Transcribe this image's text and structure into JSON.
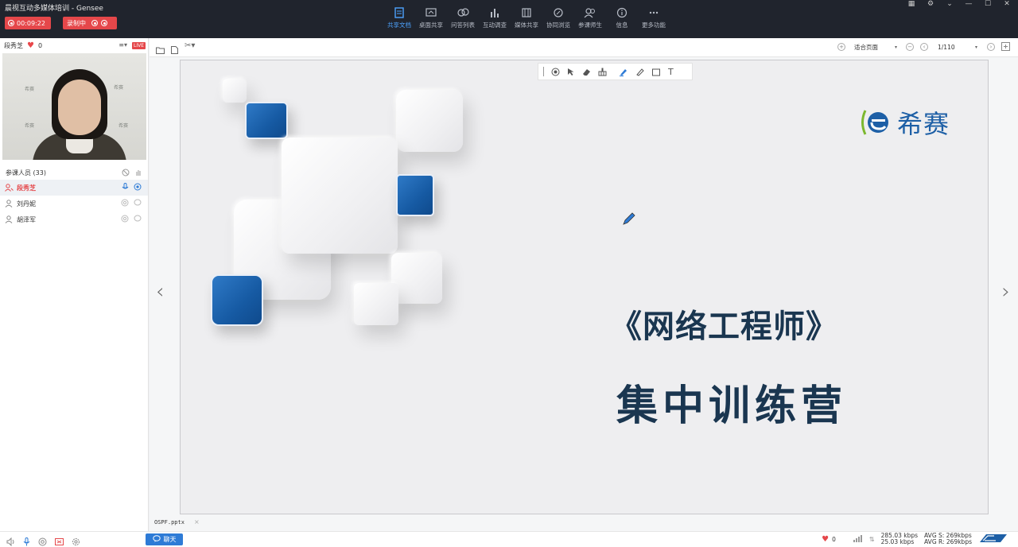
{
  "window": {
    "title": "晨视互动多媒体培训 - Gensee",
    "timer": "00:09:22",
    "record_label": "录制中"
  },
  "top_tools": [
    {
      "label": "共享文档",
      "icon": "document-icon",
      "active": true
    },
    {
      "label": "桌面共享",
      "icon": "desktop-share-icon"
    },
    {
      "label": "问答列表",
      "icon": "qa-icon"
    },
    {
      "label": "互动调查",
      "icon": "survey-icon"
    },
    {
      "label": "媒体共享",
      "icon": "media-icon"
    },
    {
      "label": "协同浏览",
      "icon": "browser-icon"
    },
    {
      "label": "参课师生",
      "icon": "users-icon"
    },
    {
      "label": "信息",
      "icon": "info-icon"
    },
    {
      "label": "更多功能",
      "icon": "more-icon"
    }
  ],
  "presenter": {
    "name": "段秀芝",
    "likes": "0",
    "live": "LIVE",
    "video_labels": [
      "希赛",
      "希赛",
      "希赛",
      "希赛"
    ]
  },
  "participants": {
    "header": "参课人员 (33)",
    "members": [
      {
        "name": "段秀芝",
        "active": true
      },
      {
        "name": "刘丹妮"
      },
      {
        "name": "胡泽军"
      }
    ]
  },
  "doc_toolbar": {
    "zoom": "适合页面",
    "page": "1/110"
  },
  "slide": {
    "logo_text": "希赛",
    "title": "《网络工程师》",
    "subtitle": "集中训练营"
  },
  "file_tab": "OSPF.pptx",
  "status": {
    "chat_label": "聊天",
    "likes": "0",
    "up_rate": "285.03 kbps",
    "down_rate": "25.03 kbps",
    "avg_s": "AVG S: 269kbps",
    "avg_r": "AVG R: 269kbps"
  },
  "colors": {
    "titlebar": "#20242d",
    "accent_red": "#e5474a",
    "accent_blue": "#2e7bd6",
    "slide_title": "#1a3650",
    "brand_blue": "#1d5fa6"
  }
}
